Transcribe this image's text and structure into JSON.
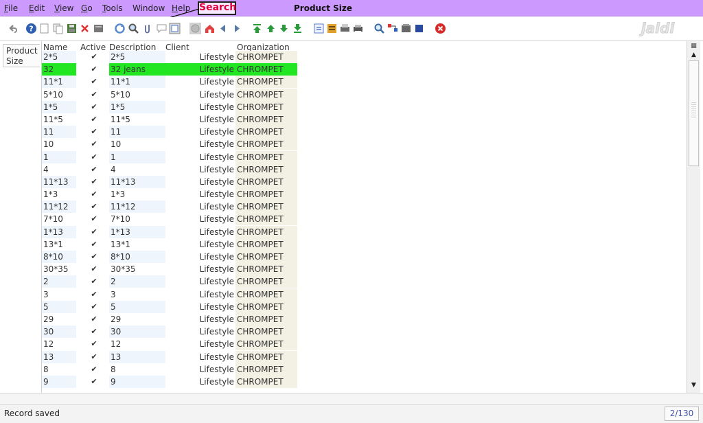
{
  "menu": {
    "items": [
      {
        "label": "File",
        "u": "F",
        "rest": "ile"
      },
      {
        "label": "Edit",
        "u": "E",
        "rest": "dit"
      },
      {
        "label": "View",
        "u": "V",
        "rest": "iew"
      },
      {
        "label": "Go",
        "u": "G",
        "rest": "o"
      },
      {
        "label": "Tools",
        "u": "T",
        "rest": "ools"
      },
      {
        "label": "Window",
        "u": "",
        "rest": "Window"
      },
      {
        "label": "Help",
        "u": "H",
        "rest": "elp"
      }
    ],
    "window_title": "Product Size",
    "annotation": "Search"
  },
  "toolbar": {
    "logo_text": "jaldi",
    "icons": [
      "undo-icon",
      "help-icon",
      "new-record-icon",
      "copy-record-icon",
      "save-icon",
      "delete-icon",
      "delete-selection-icon",
      "refresh-icon",
      "search-icon",
      "attachment-icon",
      "chat-icon",
      "grid-toggle-icon",
      "history-icon",
      "home-icon",
      "back-icon",
      "forward-icon",
      "first-record-icon",
      "previous-record-icon",
      "next-record-icon",
      "last-record-icon",
      "report-icon",
      "archive-icon",
      "print-preview-icon",
      "print-icon",
      "zoom-across-icon",
      "workflow-icon",
      "product-info-icon",
      "end-session-icon",
      "close-window-icon"
    ]
  },
  "tab": {
    "label": "Product Size"
  },
  "grid": {
    "columns": [
      "Name",
      "Active",
      "Description",
      "Client",
      "Organization"
    ],
    "rows": [
      {
        "name": "2*5",
        "active": true,
        "description": "2*5",
        "client": "Lifestyle",
        "org": "CHROMPET"
      },
      {
        "name": "32",
        "active": true,
        "description": "32 jeans",
        "client": "Lifestyle",
        "org": "CHROMPET",
        "selected": true
      },
      {
        "name": "11*1",
        "active": true,
        "description": "11*1",
        "client": "Lifestyle",
        "org": "CHROMPET"
      },
      {
        "name": "5*10",
        "active": true,
        "description": "5*10",
        "client": "Lifestyle",
        "org": "CHROMPET"
      },
      {
        "name": "1*5",
        "active": true,
        "description": "1*5",
        "client": "Lifestyle",
        "org": "CHROMPET"
      },
      {
        "name": "11*5",
        "active": true,
        "description": "11*5",
        "client": "Lifestyle",
        "org": "CHROMPET"
      },
      {
        "name": "11",
        "active": true,
        "description": "11",
        "client": "Lifestyle",
        "org": "CHROMPET"
      },
      {
        "name": "10",
        "active": true,
        "description": "10",
        "client": "Lifestyle",
        "org": "CHROMPET"
      },
      {
        "name": "1",
        "active": true,
        "description": "1",
        "client": "Lifestyle",
        "org": "CHROMPET"
      },
      {
        "name": "4",
        "active": true,
        "description": "4",
        "client": "Lifestyle",
        "org": "CHROMPET"
      },
      {
        "name": "11*13",
        "active": true,
        "description": "11*13",
        "client": "Lifestyle",
        "org": "CHROMPET"
      },
      {
        "name": "1*3",
        "active": true,
        "description": "1*3",
        "client": "Lifestyle",
        "org": "CHROMPET"
      },
      {
        "name": "11*12",
        "active": true,
        "description": "11*12",
        "client": "Lifestyle",
        "org": "CHROMPET"
      },
      {
        "name": "7*10",
        "active": true,
        "description": "7*10",
        "client": "Lifestyle",
        "org": "CHROMPET"
      },
      {
        "name": "1*13",
        "active": true,
        "description": "1*13",
        "client": "Lifestyle",
        "org": "CHROMPET"
      },
      {
        "name": "13*1",
        "active": true,
        "description": "13*1",
        "client": "Lifestyle",
        "org": "CHROMPET"
      },
      {
        "name": "8*10",
        "active": true,
        "description": "8*10",
        "client": "Lifestyle",
        "org": "CHROMPET"
      },
      {
        "name": "30*35",
        "active": true,
        "description": "30*35",
        "client": "Lifestyle",
        "org": "CHROMPET"
      },
      {
        "name": "2",
        "active": true,
        "description": "2",
        "client": "Lifestyle",
        "org": "CHROMPET"
      },
      {
        "name": "3",
        "active": true,
        "description": "3",
        "client": "Lifestyle",
        "org": "CHROMPET"
      },
      {
        "name": "5",
        "active": true,
        "description": "5",
        "client": "Lifestyle",
        "org": "CHROMPET"
      },
      {
        "name": "29",
        "active": true,
        "description": "29",
        "client": "Lifestyle",
        "org": "CHROMPET"
      },
      {
        "name": "30",
        "active": true,
        "description": "30",
        "client": "Lifestyle",
        "org": "CHROMPET"
      },
      {
        "name": "12",
        "active": true,
        "description": "12",
        "client": "Lifestyle",
        "org": "CHROMPET"
      },
      {
        "name": "13",
        "active": true,
        "description": "13",
        "client": "Lifestyle",
        "org": "CHROMPET"
      },
      {
        "name": "8",
        "active": true,
        "description": "8",
        "client": "Lifestyle",
        "org": "CHROMPET"
      },
      {
        "name": "9",
        "active": true,
        "description": "9",
        "client": "Lifestyle",
        "org": "CHROMPET"
      }
    ]
  },
  "status": {
    "message": "Record saved",
    "record_counter": "2/130"
  },
  "colors": {
    "menubar": "#cc99ff",
    "selected_row": "#22e622",
    "annotation_text": "#e0003a"
  }
}
